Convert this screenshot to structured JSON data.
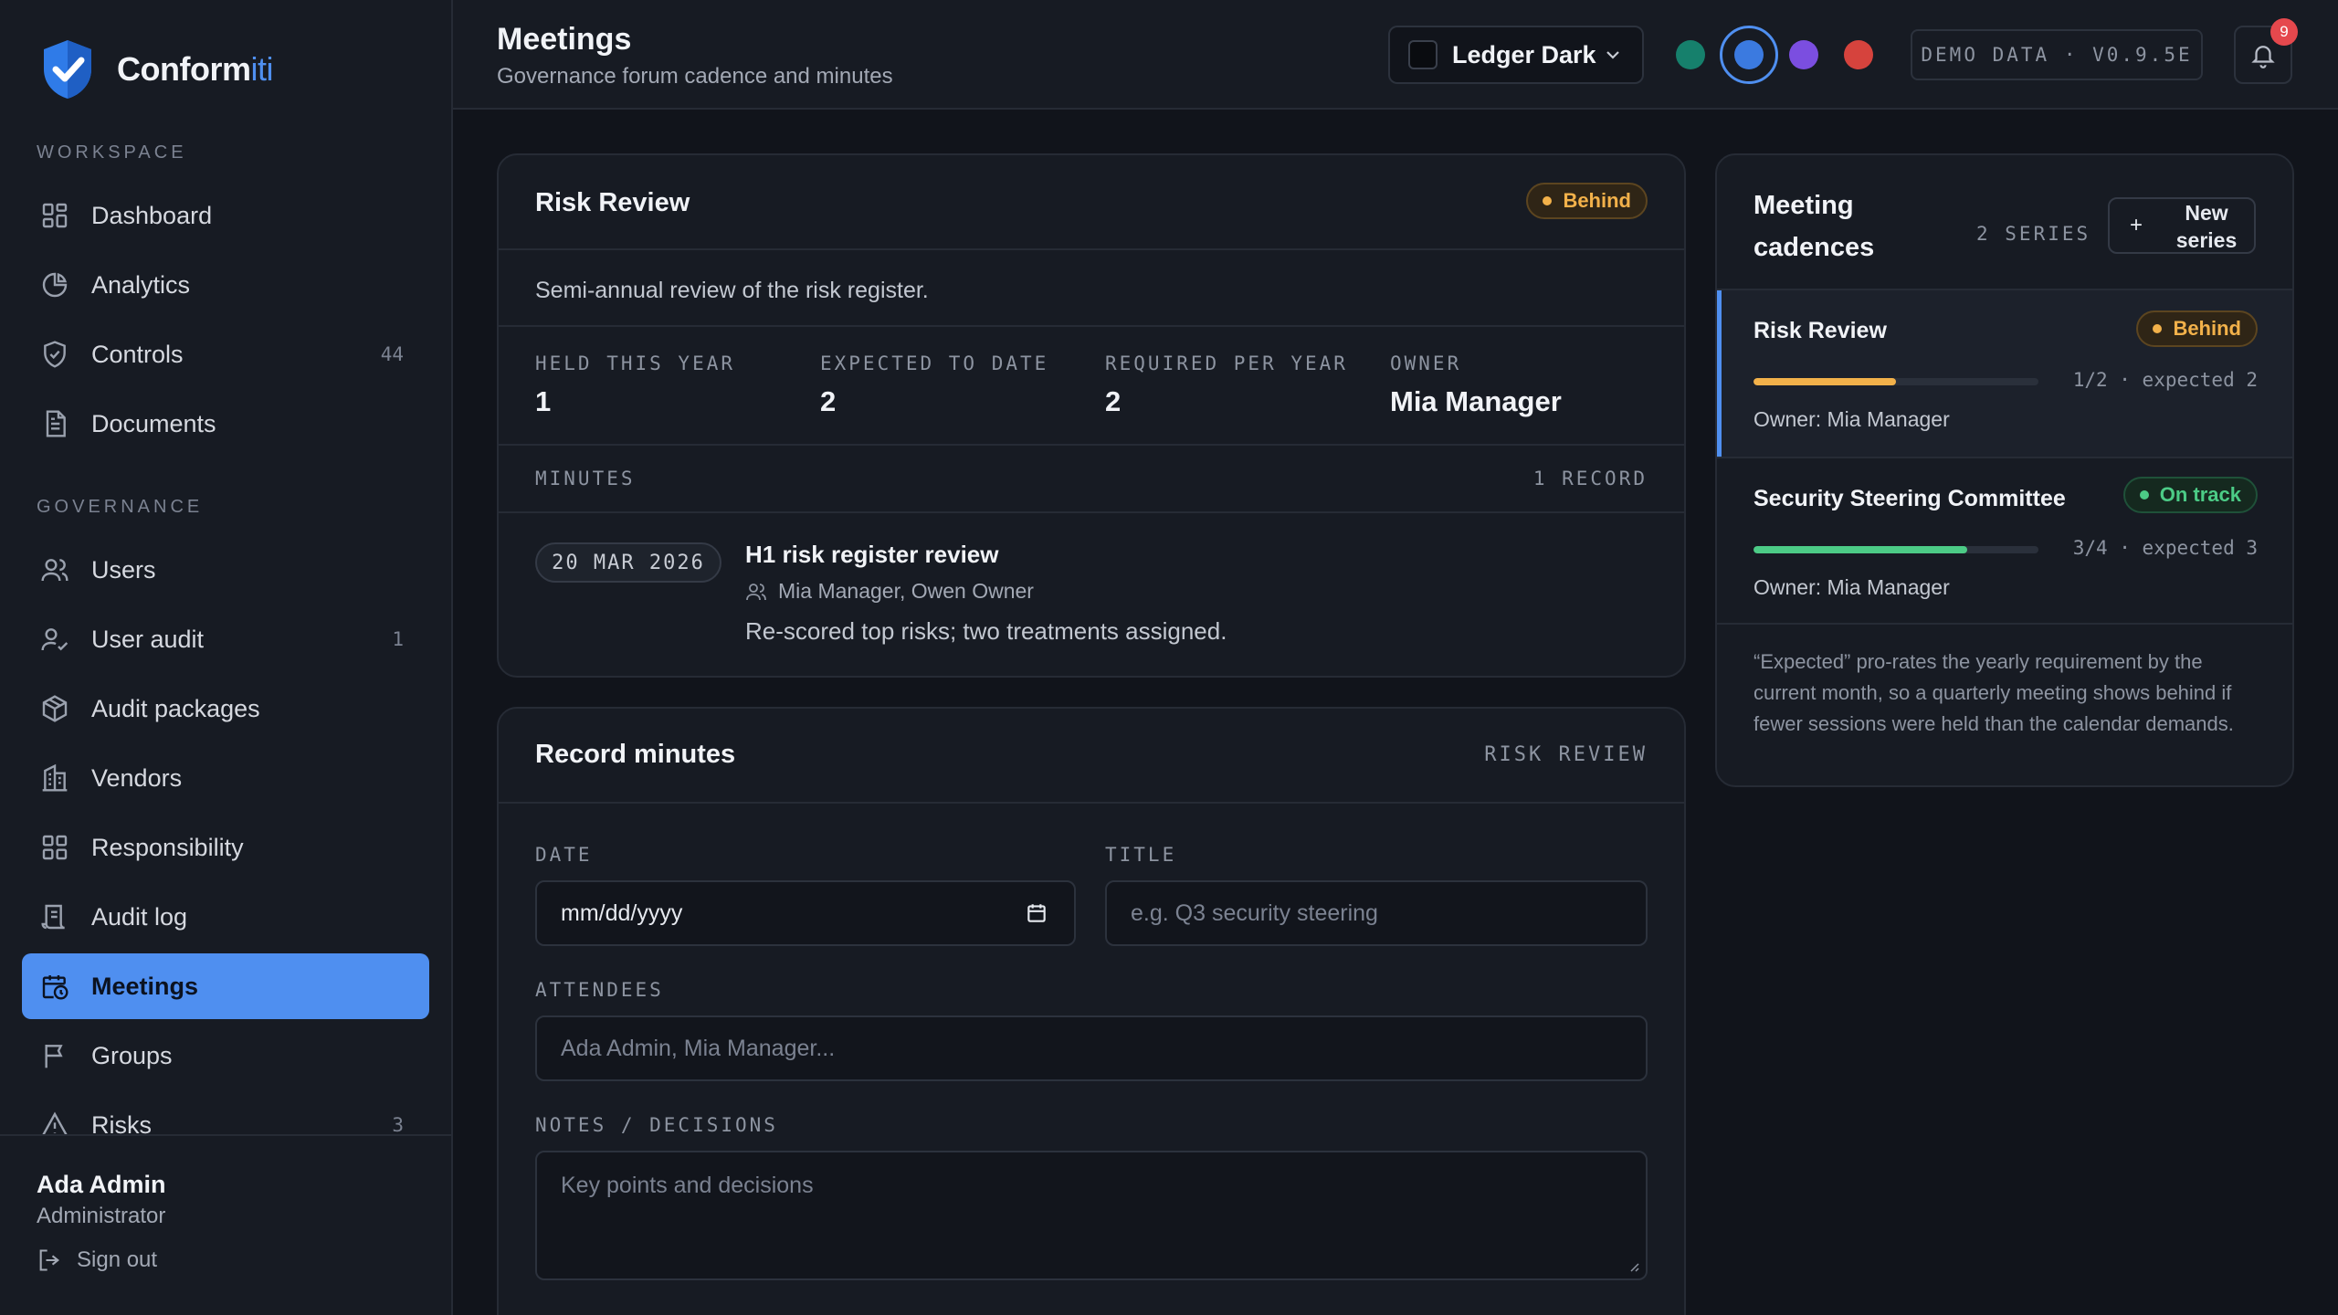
{
  "app": {
    "name_main": "Conform",
    "name_accent": "iti"
  },
  "sidebar": {
    "workspace_label": "WORKSPACE",
    "governance_label": "GOVERNANCE",
    "workspace_items": [
      {
        "label": "Dashboard",
        "icon": "grid-icon"
      },
      {
        "label": "Analytics",
        "icon": "pie-chart-icon"
      },
      {
        "label": "Controls",
        "icon": "shield-check-icon",
        "count": "44"
      },
      {
        "label": "Documents",
        "icon": "file-text-icon"
      }
    ],
    "governance_items": [
      {
        "label": "Users",
        "icon": "users-icon"
      },
      {
        "label": "User audit",
        "icon": "user-check-icon",
        "count": "1"
      },
      {
        "label": "Audit packages",
        "icon": "package-icon"
      },
      {
        "label": "Vendors",
        "icon": "building-icon"
      },
      {
        "label": "Responsibility",
        "icon": "grid-icon"
      },
      {
        "label": "Audit log",
        "icon": "scroll-icon"
      },
      {
        "label": "Meetings",
        "icon": "calendar-clock-icon",
        "active": true
      },
      {
        "label": "Groups",
        "icon": "flag-icon"
      },
      {
        "label": "Risks",
        "icon": "alert-triangle-icon",
        "count": "3"
      }
    ],
    "user": {
      "name": "Ada Admin",
      "role": "Administrator",
      "signout": "Sign out"
    }
  },
  "header": {
    "title": "Meetings",
    "subtitle": "Governance forum cadence and minutes",
    "theme": "Ledger Dark",
    "accent_colors": [
      "#16806c",
      "#3b7ae0",
      "#7b4ee0",
      "#d6433d"
    ],
    "demo_badge": "DEMO DATA · V0.9.5E",
    "notification_count": "9"
  },
  "detail": {
    "title": "Risk Review",
    "status": "Behind",
    "description": "Semi-annual review of the risk register.",
    "stats": [
      {
        "label": "HELD THIS YEAR",
        "value": "1"
      },
      {
        "label": "EXPECTED TO DATE",
        "value": "2"
      },
      {
        "label": "REQUIRED PER YEAR",
        "value": "2"
      },
      {
        "label": "OWNER",
        "value": "Mia Manager"
      }
    ],
    "minutes_label": "MINUTES",
    "minutes_count": "1 RECORD",
    "minutes": [
      {
        "date": "20 MAR 2026",
        "title": "H1 risk register review",
        "attendees": "Mia Manager, Owen Owner",
        "notes": "Re-scored top risks; two treatments assigned."
      }
    ]
  },
  "form": {
    "title": "Record minutes",
    "context": "RISK REVIEW",
    "date_label": "DATE",
    "date_value": "mm/dd/yyyy",
    "title_label": "TITLE",
    "title_placeholder": "e.g. Q3 security steering",
    "attendees_label": "ATTENDEES",
    "attendees_placeholder": "Ada Admin, Mia Manager...",
    "notes_label": "NOTES / DECISIONS",
    "notes_placeholder": "Key points and decisions"
  },
  "cadences": {
    "title": "Meeting cadences",
    "series_count": "2 SERIES",
    "new_button": "New series",
    "series": [
      {
        "name": "Risk Review",
        "status": "Behind",
        "held": 1,
        "required": 2,
        "progress_text": "1/2 · expected 2",
        "owner": "Owner: Mia Manager",
        "color": "#f2b14a"
      },
      {
        "name": "Security Steering Committee",
        "status": "On track",
        "held": 3,
        "required": 4,
        "progress_text": "3/4 · expected 3",
        "owner": "Owner: Mia Manager",
        "color": "#4ccb86"
      }
    ],
    "note": "“Expected” pro-rates the yearly requirement by the current month, so a quarterly meeting shows behind if fewer sessions were held than the calendar demands."
  }
}
